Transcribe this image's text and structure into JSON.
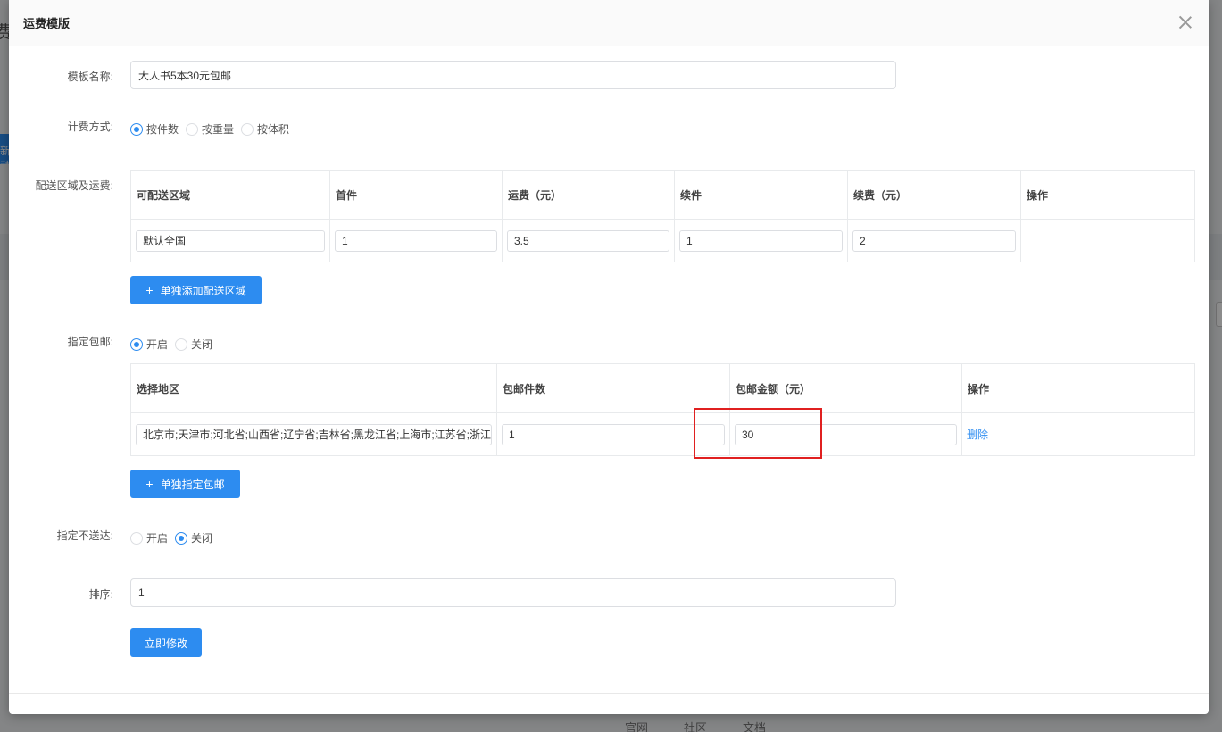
{
  "background": {
    "left_char": "费",
    "left_button": "新动",
    "footer_links": [
      "官网",
      "社区",
      "文档"
    ]
  },
  "modal": {
    "title": "运费模版",
    "close_icon": "close-icon"
  },
  "form": {
    "template_name": {
      "label": "模板名称:",
      "value": "大人书5本30元包邮"
    },
    "billing": {
      "label": "计费方式:",
      "options": [
        "按件数",
        "按重量",
        "按体积"
      ],
      "selected": "按件数"
    },
    "delivery": {
      "label": "配送区域及运费:",
      "headers": [
        "可配送区域",
        "首件",
        "运费（元）",
        "续件",
        "续费（元）",
        "操作"
      ],
      "rows": [
        {
          "region": "默认全国",
          "first": "1",
          "fee": "3.5",
          "extra": "1",
          "extra_fee": "2",
          "action": ""
        }
      ],
      "add_button": "单独添加配送区域"
    },
    "free_shipping": {
      "label": "指定包邮:",
      "options": [
        "开启",
        "关闭"
      ],
      "selected": "开启",
      "headers": [
        "选择地区",
        "包邮件数",
        "包邮金额（元）",
        "操作"
      ],
      "rows": [
        {
          "region": "北京市;天津市;河北省;山西省;辽宁省;吉林省;黑龙江省;上海市;江苏省;浙江省",
          "count": "1",
          "amount": "30",
          "action": "删除"
        }
      ],
      "add_button": "单独指定包邮"
    },
    "no_delivery": {
      "label": "指定不送达:",
      "options": [
        "开启",
        "关闭"
      ],
      "selected": "关闭"
    },
    "sort": {
      "label": "排序:",
      "value": "1"
    },
    "submit": "立即修改"
  },
  "colors": {
    "primary": "#2d8cf0",
    "highlight": "#e02020"
  }
}
